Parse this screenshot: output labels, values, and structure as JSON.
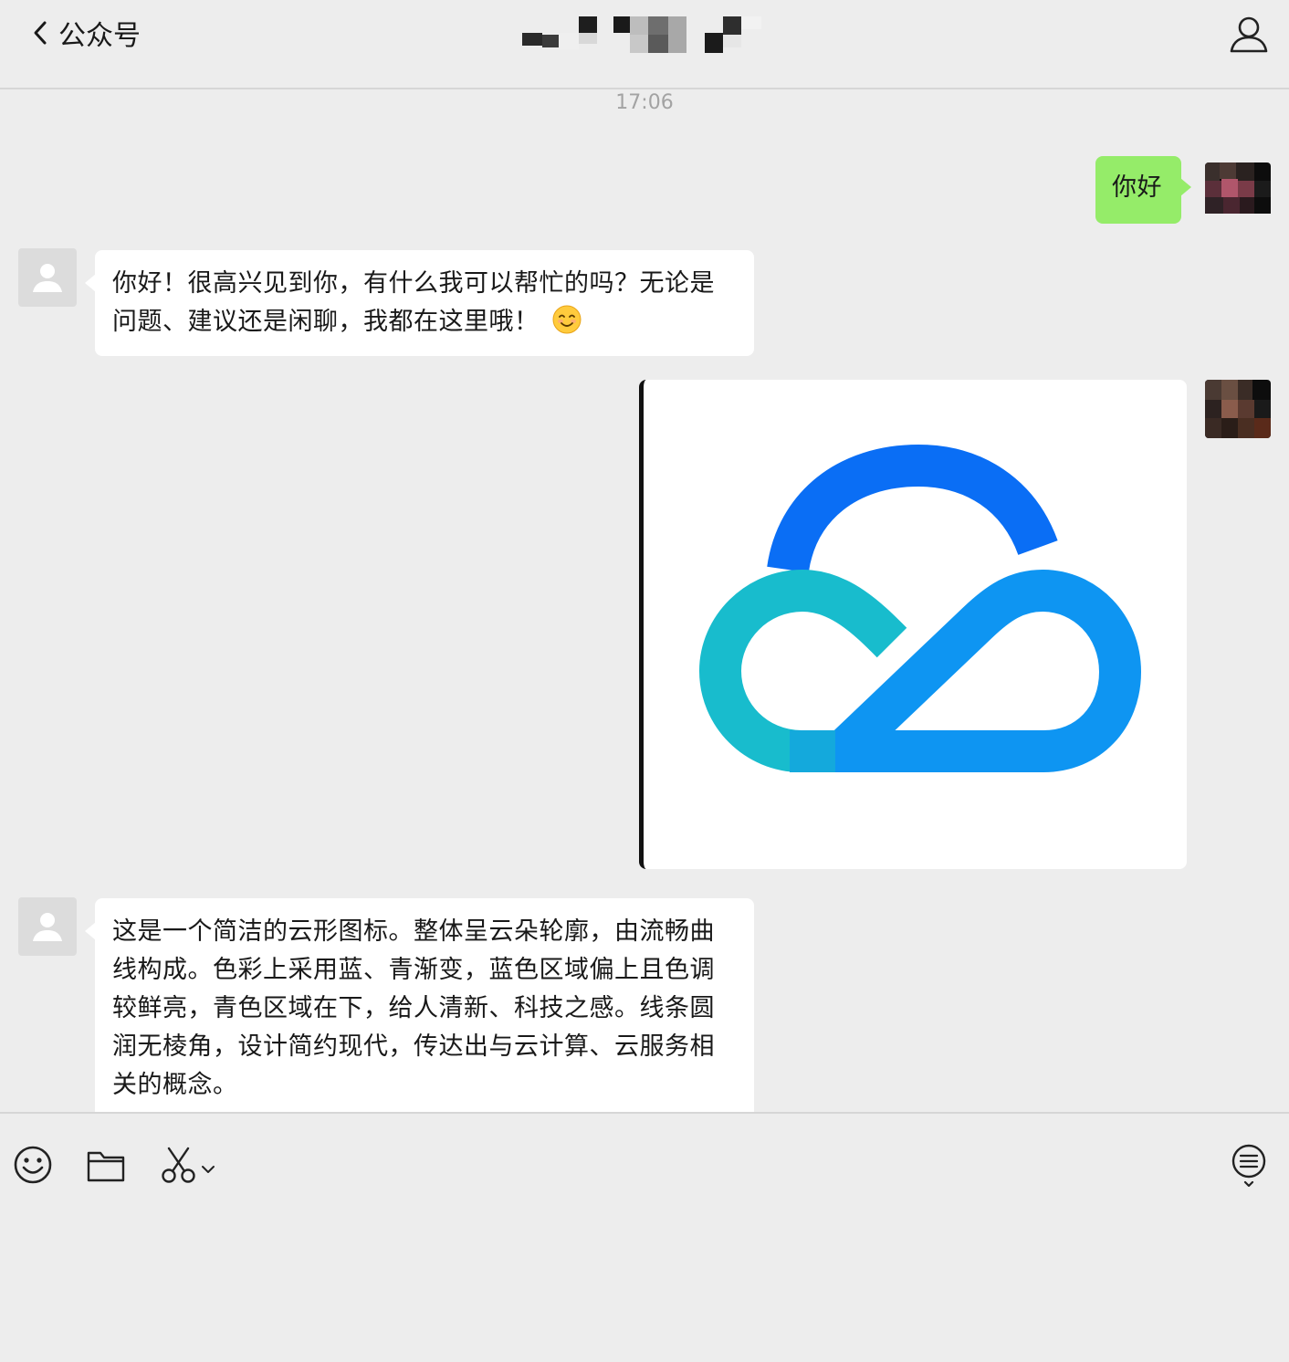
{
  "header": {
    "back_label": "公众号"
  },
  "chat": {
    "timestamp": "17:06",
    "messages": [
      {
        "sender": "me",
        "type": "text",
        "text": "你好"
      },
      {
        "sender": "bot",
        "type": "text",
        "text": "你好！很高兴见到你，有什么我可以帮忙的吗？无论是问题、建议还是闲聊，我都在这里哦！",
        "emoji": "smiling-face-emoji"
      },
      {
        "sender": "me",
        "type": "image",
        "image": "cloud-logo"
      },
      {
        "sender": "bot",
        "type": "text",
        "text": "这是一个简洁的云形图标。整体呈云朵轮廓，由流畅曲线构成。色彩上采用蓝、青渐变，蓝色区域偏上且色调较鲜亮，青色区域在下，给人清新、科技之感。线条圆润无棱角，设计简约现代，传达出与云计算、云服务相关的概念。"
      }
    ]
  },
  "toolbar": {
    "icons": [
      "emoji-icon",
      "folder-icon",
      "scissors-icon",
      "chevron-down-icon",
      "chat-history-icon"
    ]
  },
  "colors": {
    "background": "#ededed",
    "outgoing_bubble": "#95ec69",
    "incoming_bubble": "#ffffff",
    "logo_blue_dark": "#0a6ef5",
    "logo_blue_light": "#0e95f2",
    "logo_cyan": "#18bccd"
  }
}
